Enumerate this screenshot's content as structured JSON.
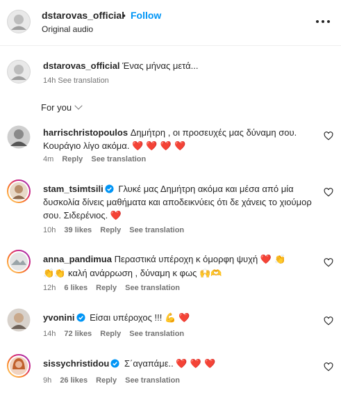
{
  "header": {
    "username": "dstarovas_official",
    "separator": "•",
    "follow_label": "Follow",
    "subtitle": "Original audio"
  },
  "caption": {
    "username": "dstarovas_official",
    "text": "Ένας μήνας μετά...",
    "time": "14h",
    "see_translation": "See translation"
  },
  "sort": {
    "label": "For you"
  },
  "comments": [
    {
      "username": "harrischristopoulos",
      "text": "Δημήτρη , οι προσευχές μας δύναμη σου. Κουράγιο λίγο ακόμα.",
      "emoji": "❤️ ❤️ ❤️ ❤️",
      "time": "4m",
      "likes": "",
      "reply": "Reply",
      "see_translation": "See translation"
    },
    {
      "username": "stam_tsimtsili",
      "verified": true,
      "text": "Γλυκέ μας Δημήτρη ακόμα και μέσα από μία δυσκολία δίνεις μαθήματα και αποδεικνύεις ότι δε χάνεις το χιούμορ σου. Σιδερένιος.",
      "emoji": "❤️",
      "time": "10h",
      "likes": "39 likes",
      "reply": "Reply",
      "see_translation": "See translation"
    },
    {
      "username": "anna_pandimua",
      "text_a": "Περαστικά υπέροχη κ όμορφη ψυχή",
      "emoji_a": "❤️ 👏",
      "emoji_b": "👏👏",
      "text_b": "καλή ανάρρωση , δύναμη κ φως",
      "emoji_c": "🙌🫶",
      "time": "12h",
      "likes": "6 likes",
      "reply": "Reply",
      "see_translation": "See translation"
    },
    {
      "username": "yvonini",
      "verified": true,
      "text": "Είσαι υπέροχος !!!",
      "emoji": "💪 ❤️",
      "time": "14h",
      "likes": "72 likes",
      "reply": "Reply",
      "see_translation": "See translation"
    },
    {
      "username": "sissychristidou",
      "verified": true,
      "text": "Σ΄αγαπάμε..",
      "emoji": "❤️ ❤️ ❤️",
      "time": "9h",
      "likes": "26 likes",
      "reply": "Reply",
      "see_translation": "See translation"
    }
  ],
  "colors": {
    "accent": "#0095f6",
    "muted": "#737373",
    "text": "#262626",
    "heart": "#e0245e",
    "story_ring": [
      "#feda75",
      "#fa7e1e",
      "#d62976",
      "#962fbf"
    ]
  },
  "icons": {
    "more": "more-horizontal-icon",
    "like": "heart-outline-icon",
    "verified": "verified-badge-icon",
    "sort": "chevron-down-icon"
  }
}
